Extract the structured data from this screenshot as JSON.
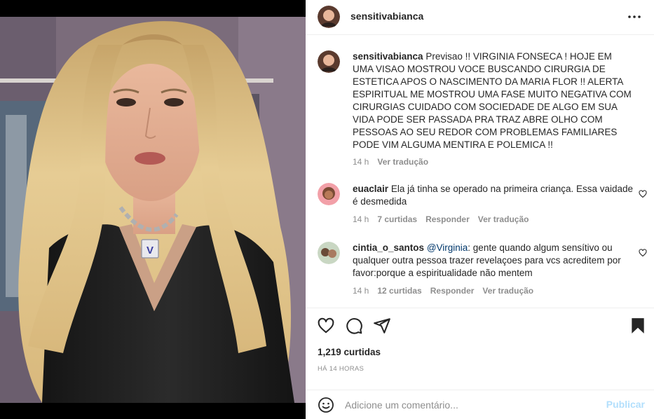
{
  "post": {
    "author": "sensitivabianca",
    "caption": "Previsao !! VIRGINIA FONSECA ! HOJE EM UMA VISAO MOSTROU VOCE BUSCANDO CIRURGIA DE ESTETICA APOS O NASCIMENTO DA MARIA FLOR !! ALERTA ESPIRITUAL ME MOSTROU UMA FASE MUITO NEGATIVA COM CIRURGIAS CUIDADO COM SOCIEDADE DE ALGO EM SUA VIDA PODE SER PASSADA PRA TRAZ ABRE OLHO COM PESSOAS AO SEU REDOR COM PROBLEMAS FAMILIARES PODE VIM ALGUMA MENTIRA E POLEMICA !!",
    "caption_time": "14 h",
    "caption_translate": "Ver tradução",
    "pendant_letter": "V"
  },
  "comments": [
    {
      "username": "euaclair",
      "text": "Ela já tinha se operado na primeira criança. Essa vaidade é desmedida",
      "time": "14 h",
      "likes": "7 curtidas",
      "reply": "Responder",
      "translate": "Ver tradução"
    },
    {
      "username": "cintia_o_santos",
      "mention": "@Virginia",
      "text": ": gente quando algum sensítivo ou qualquer outra pessoa trazer revelaçoes para vcs acreditem por favor:porque a espiritualidade não mentem",
      "time": "14 h",
      "likes": "12 curtidas",
      "reply": "Responder",
      "translate": "Ver tradução"
    }
  ],
  "stats": {
    "likes": "1,219 curtidas",
    "time_ago": "HÁ 14 HORAS"
  },
  "comment_box": {
    "placeholder": "Adicione um comentário...",
    "publish": "Publicar"
  },
  "icons": {
    "more": "more-horizontal-icon",
    "like": "heart-icon",
    "comment": "comment-icon",
    "share": "send-icon",
    "save": "bookmark-icon",
    "emoji": "emoji-icon"
  },
  "colors": {
    "link": "#00376b",
    "muted": "#8e8e8e",
    "publish_disabled": "#b2dffc",
    "divider": "#efefef"
  }
}
